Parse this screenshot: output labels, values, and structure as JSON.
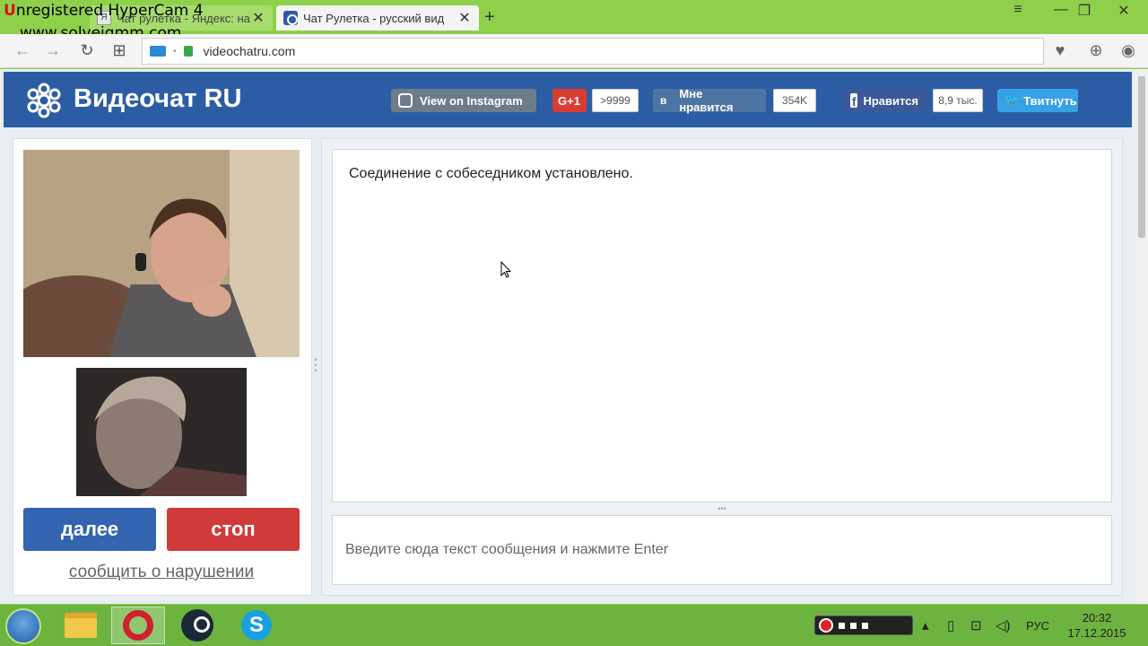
{
  "watermark": {
    "line1_prefix": "U",
    "line1_rest": "nregistered HyperCam 4",
    "line2": "www.solveigmm.com"
  },
  "browser": {
    "tabs": [
      {
        "label": "Чат рулетка - Яндекс: на",
        "active": false
      },
      {
        "label": "Чат Рулетка - русский вид",
        "active": true
      }
    ],
    "address": {
      "url": "videochatru.com"
    }
  },
  "site": {
    "logo_text": "Видеочат RU",
    "social": {
      "instagram_label": "View on Instagram",
      "gplus_label": "G+1",
      "gplus_count": ">9999",
      "vk_label": "Мне нравится",
      "vk_count": "354K",
      "fb_label": "Нравится",
      "fb_count": "8,9 тыс.",
      "twitter_label": "Твитнуть"
    },
    "buttons": {
      "next": "далее",
      "stop": "стоп",
      "report": "сообщить о нарушении"
    },
    "chat": {
      "message": "Соединение с собеседником установлено.",
      "input_placeholder": "Введите сюда текст сообщения и нажмите Enter"
    }
  },
  "taskbar": {
    "language": "РУС",
    "time": "20:32",
    "date": "17.12.2015"
  }
}
